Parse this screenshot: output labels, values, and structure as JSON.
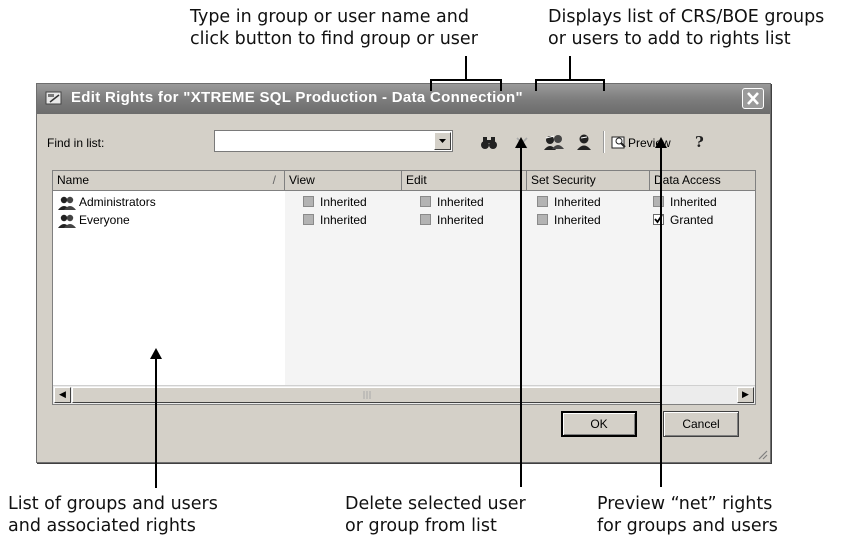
{
  "callouts": {
    "find": "Type in group or user name and\nclick button to find group or user",
    "browse": "Displays list of CRS/BOE groups\nor users to add to rights list",
    "list": "List of groups and users\nand associated rights",
    "delete": "Delete selected user\nor group from list",
    "preview": "Preview “net” rights\nfor groups and users"
  },
  "dialog": {
    "title": "Edit Rights for \"XTREME SQL Production - Data Connection\"",
    "find_label": "Find in list:",
    "find_value": "",
    "preview_label": "Preview",
    "ok_label": "OK",
    "cancel_label": "Cancel"
  },
  "list": {
    "columns": [
      "Name",
      "View",
      "Edit",
      "Set Security",
      "Data Access"
    ],
    "sort_indicator": "/",
    "rows": [
      {
        "name": "Administrators",
        "view": "Inherited",
        "edit": "Inherited",
        "security": "Inherited",
        "access": "Inherited",
        "access_checked": false
      },
      {
        "name": "Everyone",
        "view": "Inherited",
        "edit": "Inherited",
        "security": "Inherited",
        "access": "Granted",
        "access_checked": true
      }
    ]
  },
  "icons": [
    "dialog-app-icon",
    "close-icon",
    "dropdown-arrow-icon",
    "binoculars-icon",
    "delete-x-icon",
    "add-group-icon",
    "add-user-icon",
    "preview-icon",
    "help-icon",
    "group-icon",
    "scroll-left-icon",
    "scroll-right-icon",
    "resize-grip-icon"
  ]
}
